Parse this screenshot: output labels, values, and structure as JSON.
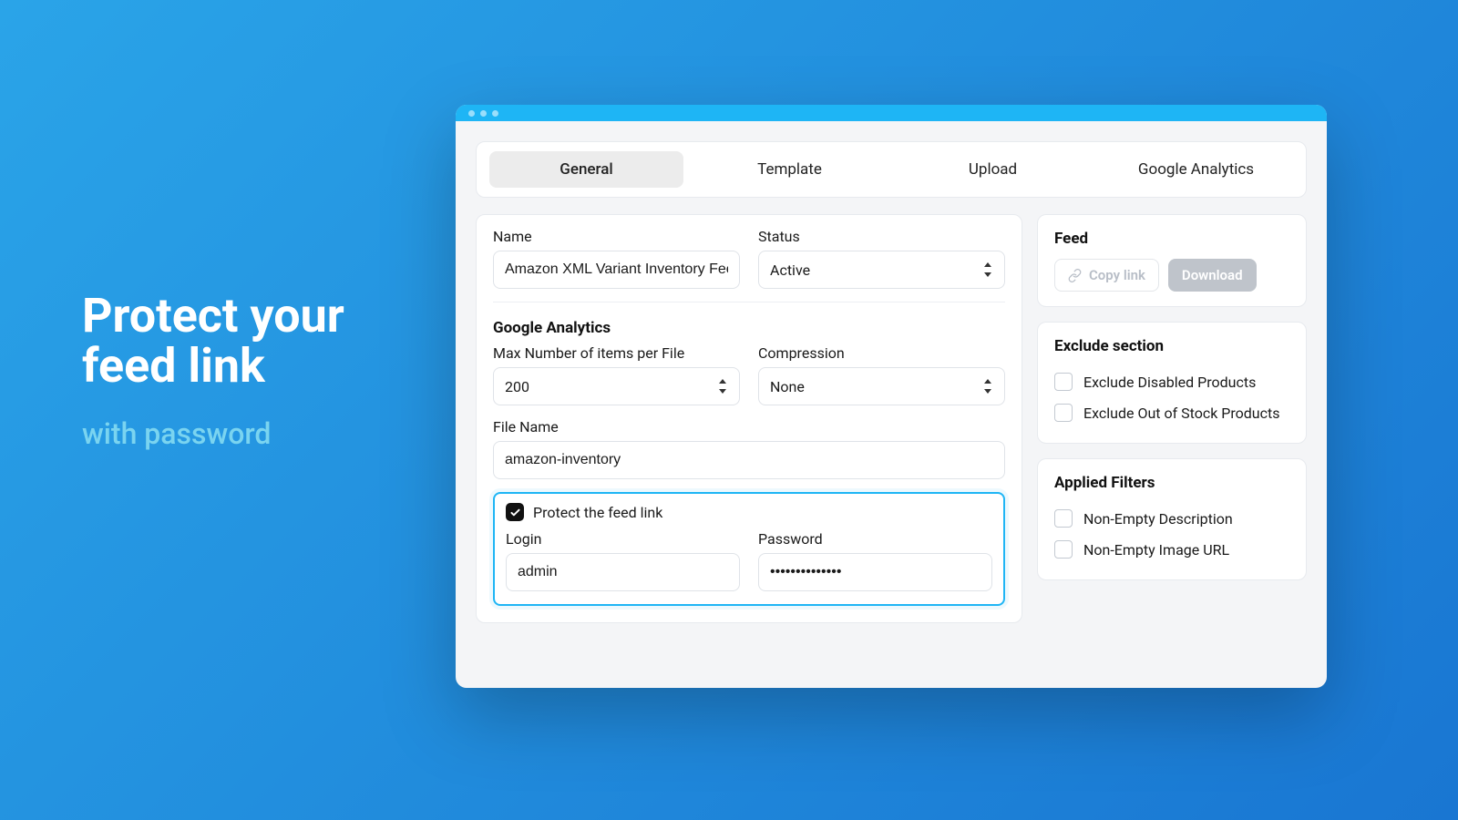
{
  "promo": {
    "title_line1": "Protect your",
    "title_line2": "feed link",
    "subtitle": "with password"
  },
  "tabs": [
    "General",
    "Template",
    "Upload",
    "Google Analytics"
  ],
  "form": {
    "name_label": "Name",
    "name_value": "Amazon XML Variant Inventory Feed",
    "status_label": "Status",
    "status_value": "Active",
    "ga_section": "Google Analytics",
    "max_items_label": "Max Number of items per File",
    "max_items_value": "200",
    "compression_label": "Compression",
    "compression_value": "None",
    "filename_label": "File Name",
    "filename_value": "amazon-inventory",
    "protect_label": "Protect the feed link",
    "login_label": "Login",
    "login_value": "admin",
    "password_label": "Password",
    "password_value": "••••••••••••••"
  },
  "feed_card": {
    "title": "Feed",
    "copy": "Copy link",
    "download": "Download"
  },
  "exclude_card": {
    "title": "Exclude section",
    "opt1": "Exclude Disabled Products",
    "opt2": "Exclude Out of Stock Products"
  },
  "filters_card": {
    "title": "Applied Filters",
    "opt1": "Non-Empty Description",
    "opt2": "Non-Empty Image URL"
  }
}
